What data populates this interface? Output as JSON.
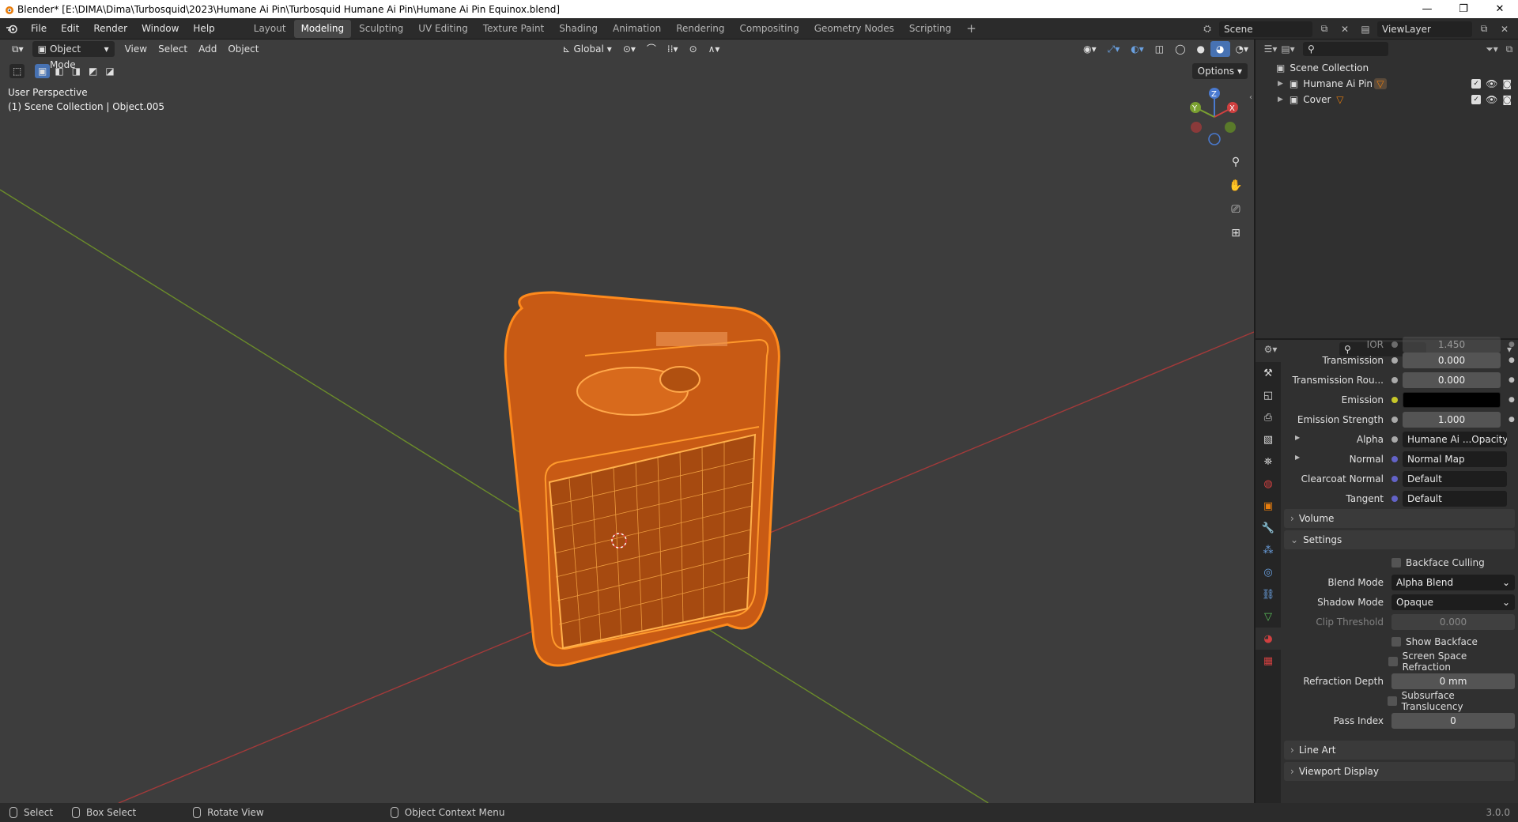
{
  "window": {
    "title": "Blender* [E:\\DIMA\\Dima\\Turbosquid\\2023\\Humane Ai Pin\\Turbosquid Humane Ai Pin\\Humane Ai Pin Equinox.blend]",
    "controls": [
      "—",
      "❐",
      "✕"
    ]
  },
  "topbar": {
    "menus": [
      "File",
      "Edit",
      "Render",
      "Window",
      "Help"
    ],
    "workspaces": [
      "Layout",
      "Modeling",
      "Sculpting",
      "UV Editing",
      "Texture Paint",
      "Shading",
      "Animation",
      "Rendering",
      "Compositing",
      "Geometry Nodes",
      "Scripting"
    ],
    "active_workspace": "Modeling",
    "add_tab": "+",
    "scene": "Scene",
    "view_layer": "ViewLayer"
  },
  "viewport_header": {
    "mode": "Object Mode",
    "menus": [
      "View",
      "Select",
      "Add",
      "Object"
    ],
    "transform_orientation": "Global",
    "options": "Options"
  },
  "viewport": {
    "perspective": "User Perspective",
    "context": "(1) Scene Collection | Object.005",
    "gizmo_axes": [
      "Z",
      "Y",
      "X"
    ]
  },
  "outliner": {
    "root": "Scene Collection",
    "items": [
      {
        "name": "Humane Ai Pin"
      },
      {
        "name": "Cover"
      }
    ]
  },
  "properties": {
    "rows": [
      {
        "label": "IOR",
        "value": "1.450",
        "type": "num"
      },
      {
        "label": "Transmission",
        "value": "0.000",
        "type": "num"
      },
      {
        "label": "Transmission Rou...",
        "value": "0.000",
        "type": "num"
      },
      {
        "label": "Emission",
        "value": "",
        "type": "color"
      },
      {
        "label": "Emission Strength",
        "value": "1.000",
        "type": "num"
      },
      {
        "label": "Alpha",
        "value": "Humane Ai ...Opacity.png",
        "type": "link"
      },
      {
        "label": "Normal",
        "value": "Normal Map",
        "type": "link"
      },
      {
        "label": "Clearcoat Normal",
        "value": "Default",
        "type": "link"
      },
      {
        "label": "Tangent",
        "value": "Default",
        "type": "link"
      }
    ],
    "panels": {
      "volume": "Volume",
      "settings": "Settings",
      "line_art": "Line Art",
      "viewport_display": "Viewport Display"
    },
    "settings": {
      "backface_culling": "Backface Culling",
      "blend_mode_label": "Blend Mode",
      "blend_mode": "Alpha Blend",
      "shadow_mode_label": "Shadow Mode",
      "shadow_mode": "Opaque",
      "clip_threshold_label": "Clip Threshold",
      "clip_threshold": "0.000",
      "show_backface": "Show Backface",
      "ssr": "Screen Space Refraction",
      "refraction_depth_label": "Refraction Depth",
      "refraction_depth": "0 mm",
      "subsurface": "Subsurface Translucency",
      "pass_index_label": "Pass Index",
      "pass_index": "0"
    },
    "colors": {
      "emission": "#000000",
      "accent": "#e87d0d",
      "dot_yellow": "#c7c729",
      "dot_blue": "#6363c7"
    }
  },
  "statusbar": {
    "select": "Select",
    "box_select": "Box Select",
    "rotate_view": "Rotate View",
    "context_menu": "Object Context Menu",
    "version": "3.0.0"
  }
}
